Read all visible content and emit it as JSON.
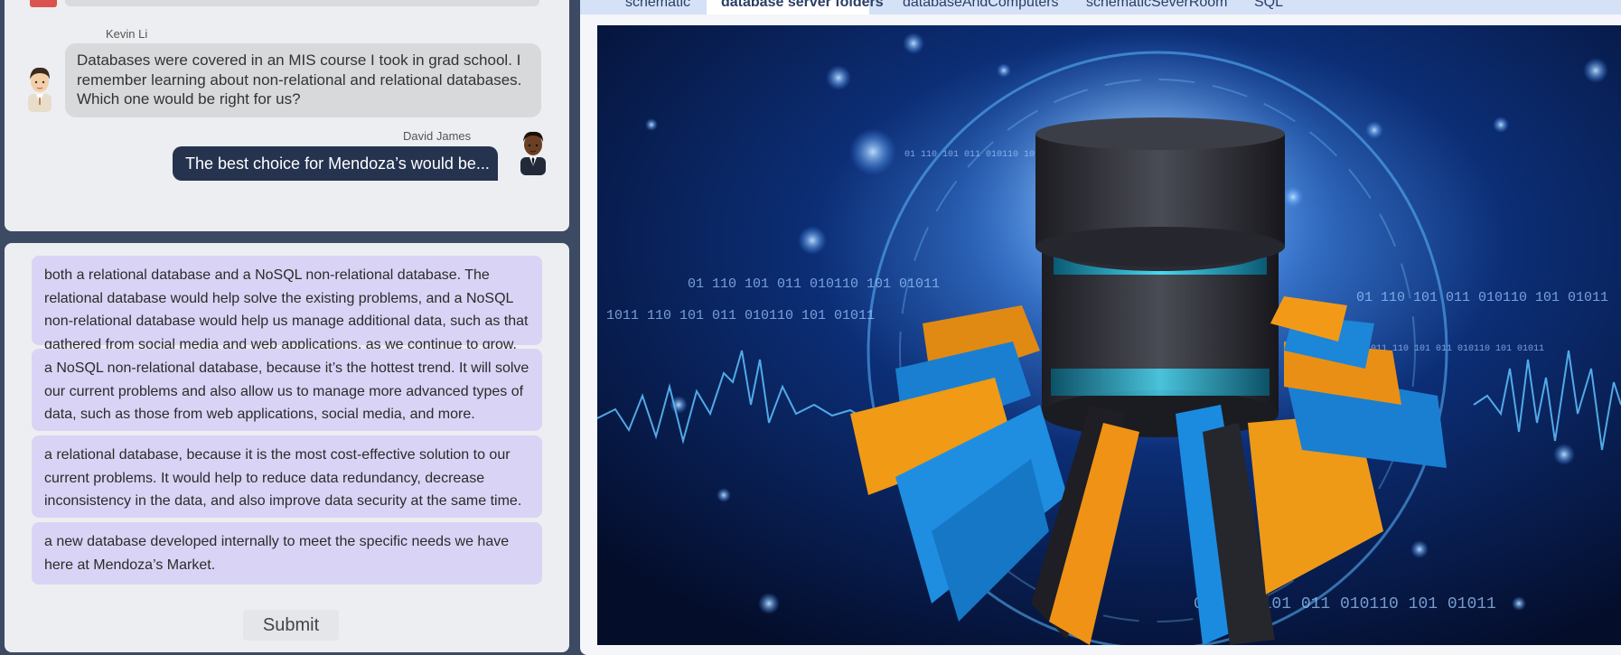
{
  "chat": {
    "messages": [
      {
        "sender": "Kevin Li",
        "text": "Databases were covered in an MIS course I took in grad school. I remember learning about non-relational and relational databases. Which one would be right for us?"
      },
      {
        "sender": "David James",
        "text": "The best choice for Mendoza’s would be..."
      }
    ]
  },
  "options": [
    "both a relational database and a NoSQL non-relational database. The relational database would help solve the existing problems, and a NoSQL non-relational database would help us manage additional data, such as that gathered from social media and web applications, as we continue to grow.",
    "a NoSQL non-relational database, because it’s the hottest trend. It will solve our current problems and also allow us to manage more advanced types of data, such as those from web applications, social media, and more.",
    "a relational database, because it is the most cost-effective solution to our current problems. It would help to reduce data redundancy, decrease inconsistency in the data, and also improve data security at the same time.",
    "a new database developed internally to meet the specific needs we have here at Mendoza’s Market."
  ],
  "submit_label": "Submit",
  "tabs": [
    {
      "label": "schematic",
      "active": false
    },
    {
      "label": "database server folders",
      "active": true
    },
    {
      "label": "databaseAndComputers",
      "active": false
    },
    {
      "label": "schematicSeverRoom",
      "active": false
    },
    {
      "label": "SQL",
      "active": false
    }
  ],
  "image": {
    "binary_rows": [
      "01 110 101 011 010110 101 01011",
      "01 110 101 011 010110 101 01011",
      "1011 110 101 011 010110 101 01011",
      "01 110 101 011 010110 101 01011",
      "01 110 101 011 010110 101 01011",
      "1011 110 101 011 010110 101 01011"
    ]
  },
  "colors": {
    "nav_dark": "#25334f",
    "option_bg": "#d9d4f5",
    "panel_bg": "#eceef1",
    "tab_bar": "#d4e1f7"
  }
}
